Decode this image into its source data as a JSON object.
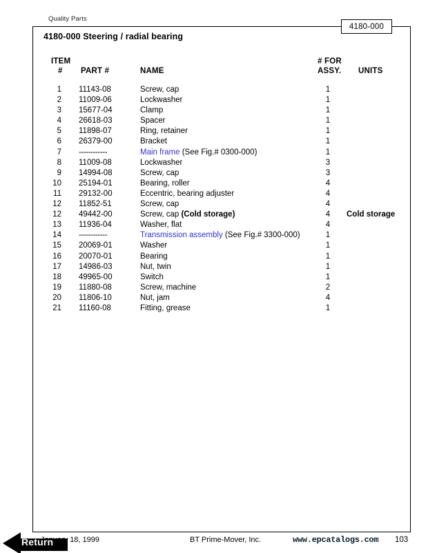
{
  "header": {
    "watermark": "Quality Parts",
    "figure_callout": "4180-000",
    "assembly_title": "4180-000 Steering / radial bearing"
  },
  "table": {
    "headers": {
      "item_line1": "ITEM",
      "item_line2": "#",
      "part": "PART #",
      "name": "NAME",
      "qty_line1": "# FOR",
      "qty_line2": "ASSY.",
      "units": "UNITS"
    },
    "dash_placeholder": "------------",
    "rows": [
      {
        "item": "1",
        "part": "11143-08",
        "name": "Screw, cap",
        "qty": "1",
        "units": ""
      },
      {
        "item": "2",
        "part": "11009-06",
        "name": "Lockwasher",
        "qty": "1",
        "units": ""
      },
      {
        "item": "3",
        "part": "15677-04",
        "name": "Clamp",
        "qty": "1",
        "units": ""
      },
      {
        "item": "4",
        "part": "26618-03",
        "name": "Spacer",
        "qty": "1",
        "units": ""
      },
      {
        "item": "5",
        "part": "11898-07",
        "name": "Ring, retainer",
        "qty": "1",
        "units": ""
      },
      {
        "item": "6",
        "part": "26379-00",
        "name": "Bracket",
        "qty": "1",
        "units": ""
      },
      {
        "item": "7",
        "part": "------------",
        "part_is_dashes": true,
        "name_link": "Main frame",
        "name_suffix": " (See Fig.# 0300-000)",
        "qty": "1",
        "units": ""
      },
      {
        "item": "8",
        "part": "11009-08",
        "name": "Lockwasher",
        "qty": "3",
        "units": ""
      },
      {
        "item": "9",
        "part": "14994-08",
        "name": "Screw, cap",
        "qty": "3",
        "units": ""
      },
      {
        "item": "10",
        "part": "25194-01",
        "name": "Bearing, roller",
        "qty": "4",
        "units": ""
      },
      {
        "item": "11",
        "part": "29132-00",
        "name": "Eccentric, bearing adjuster",
        "qty": "4",
        "units": ""
      },
      {
        "item": "12",
        "part": "11852-51",
        "name": "Screw, cap",
        "qty": "4",
        "units": ""
      },
      {
        "item": "12",
        "part": "49442-00",
        "name_prefix": "Screw, cap ",
        "name_bold": "(Cold storage)",
        "qty": "4",
        "units": "Cold storage"
      },
      {
        "item": "13",
        "part": "11936-04",
        "name": "Washer, flat",
        "qty": "4",
        "units": ""
      },
      {
        "item": "14",
        "part": "------------",
        "part_is_dashes": true,
        "name_link": "Transmission assembly",
        "name_suffix": " (See Fig.# 3300-000)",
        "qty": "1",
        "units": ""
      },
      {
        "item": "15",
        "part": "20069-01",
        "name": "Washer",
        "qty": "1",
        "units": ""
      },
      {
        "item": "16",
        "part": "20070-01",
        "name": "Bearing",
        "qty": "1",
        "units": ""
      },
      {
        "item": "17",
        "part": "14986-03",
        "name": "Nut, twin",
        "qty": "1",
        "units": ""
      },
      {
        "item": "18",
        "part": "49965-00",
        "name": "Switch",
        "qty": "1",
        "units": ""
      },
      {
        "item": "19",
        "part": "11880-08",
        "name": "Screw, machine",
        "qty": "2",
        "units": ""
      },
      {
        "item": "20",
        "part": "11806-10",
        "name": "Nut, jam",
        "qty": "4",
        "units": ""
      },
      {
        "item": "21",
        "part": "11160-08",
        "name": "Fitting, grease",
        "qty": "1",
        "units": ""
      }
    ]
  },
  "footer": {
    "date": "January 18, 1999",
    "company": "BT Prime-Mover, Inc.",
    "url": "www.epcatalogs.com",
    "page_number": "103"
  },
  "controls": {
    "return_label": "Return"
  },
  "colors": {
    "link": "#3333cc",
    "text": "#000000",
    "frame": "#000000",
    "return_background": "#000000",
    "return_text": "#ffffff"
  }
}
